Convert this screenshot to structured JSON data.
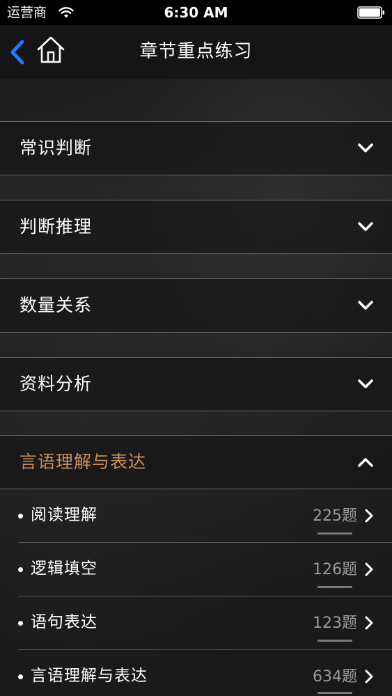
{
  "status_bar": {
    "carrier": "运营商",
    "time": "6:30 AM",
    "wifi_icon": "wifi-icon",
    "battery_icon": "battery-icon"
  },
  "nav": {
    "title": "章节重点练习",
    "back_icon": "chevron-left-icon",
    "home_icon": "home-icon"
  },
  "colors": {
    "accent": "#c98e5a",
    "back_blue": "#1e7cff",
    "count_gray": "#9a9a9a"
  },
  "sections": [
    {
      "label": "常识判断",
      "expanded": false
    },
    {
      "label": "判断推理",
      "expanded": false
    },
    {
      "label": "数量关系",
      "expanded": false
    },
    {
      "label": "资料分析",
      "expanded": false
    },
    {
      "label": "言语理解与表达",
      "expanded": true
    }
  ],
  "sub_items": [
    {
      "label": "阅读理解",
      "count": "225题"
    },
    {
      "label": "逻辑填空",
      "count": "126题"
    },
    {
      "label": "语句表达",
      "count": "123题"
    },
    {
      "label": "言语理解与表达",
      "count": "634题"
    }
  ]
}
